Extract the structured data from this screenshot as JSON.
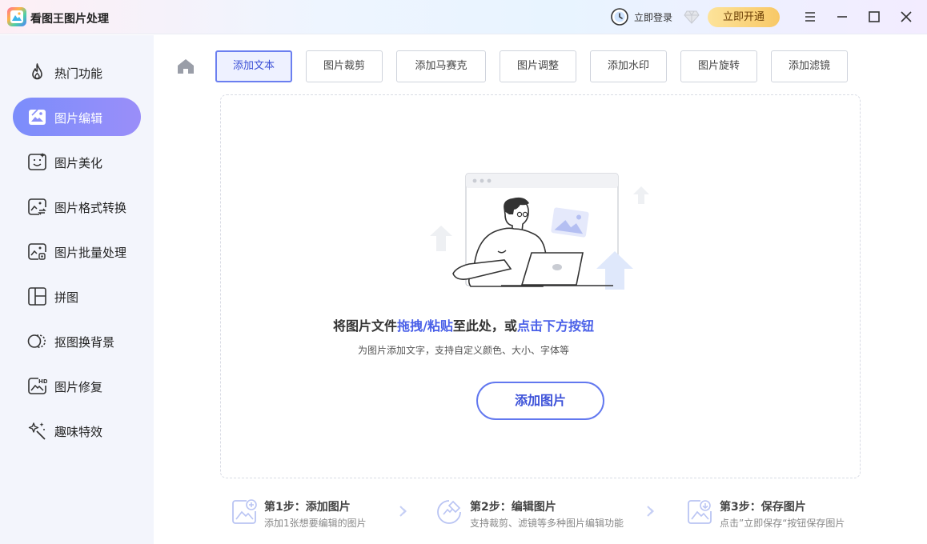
{
  "app": {
    "title": "看图王图片处理"
  },
  "titlebar": {
    "login_label": "立即登录",
    "vip_label": "立即开通",
    "menu_icon": "menu-icon",
    "minimize_icon": "minimize-icon",
    "maximize_icon": "maximize-icon",
    "close_icon": "close-icon"
  },
  "sidebar": {
    "items": [
      {
        "label": "热门功能",
        "icon": "flame-icon",
        "active": false
      },
      {
        "label": "图片编辑",
        "icon": "image-edit-icon",
        "active": true
      },
      {
        "label": "图片美化",
        "icon": "image-beautify-icon",
        "active": false
      },
      {
        "label": "图片格式转换",
        "icon": "image-convert-icon",
        "active": false
      },
      {
        "label": "图片批量处理",
        "icon": "image-batch-icon",
        "active": false
      },
      {
        "label": "拼图",
        "icon": "collage-icon",
        "active": false
      },
      {
        "label": "抠图换背景",
        "icon": "cutout-icon",
        "active": false
      },
      {
        "label": "图片修复",
        "icon": "hd-repair-icon",
        "active": false
      },
      {
        "label": "趣味特效",
        "icon": "magic-effect-icon",
        "active": false
      }
    ]
  },
  "tabs": [
    {
      "label": "添加文本",
      "active": true
    },
    {
      "label": "图片裁剪",
      "active": false
    },
    {
      "label": "添加马赛克",
      "active": false
    },
    {
      "label": "图片调整",
      "active": false
    },
    {
      "label": "添加水印",
      "active": false
    },
    {
      "label": "图片旋转",
      "active": false
    },
    {
      "label": "添加滤镜",
      "active": false
    }
  ],
  "dropzone": {
    "hint_part1": "将图片文件",
    "hint_highlight1": "拖拽/粘贴",
    "hint_part2": "至此处，或",
    "hint_highlight2": "点击下方按钮",
    "sub_text": "为图片添加文字，支持自定义颜色、大小、字体等",
    "add_button": "添加图片"
  },
  "steps": [
    {
      "title": "第1步：添加图片",
      "desc": "添加1张想要编辑的图片",
      "icon": "add-image-icon"
    },
    {
      "title": "第2步：编辑图片",
      "desc": "支持裁剪、滤镜等多种图片编辑功能",
      "icon": "edit-image-icon"
    },
    {
      "title": "第3步：保存图片",
      "desc": "点击”立即保存“按钮保存图片",
      "icon": "save-image-icon"
    }
  ],
  "colors": {
    "accent": "#6b7ff0",
    "highlight_text": "#4a60e8",
    "vip_gold": "#f8c866",
    "sidebar_bg": "#f3f5fc"
  }
}
